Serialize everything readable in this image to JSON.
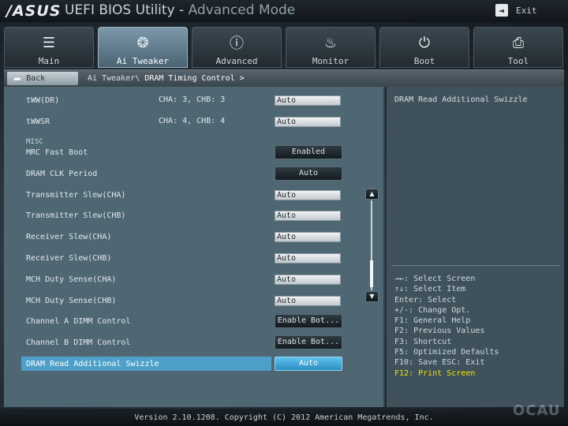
{
  "header": {
    "brand": "/ASUS",
    "title": "UEFI BIOS Utility - ",
    "mode": "Advanced Mode",
    "exit_label": "Exit"
  },
  "tabs": [
    {
      "label": "Main",
      "icon": "list-icon",
      "glyph": "☰"
    },
    {
      "label": "Ai Tweaker",
      "icon": "tweaker-icon",
      "glyph": "❂"
    },
    {
      "label": "Advanced",
      "icon": "advanced-info-icon",
      "glyph": "ⓘ"
    },
    {
      "label": "Monitor",
      "icon": "thermometer-icon",
      "glyph": "♨"
    },
    {
      "label": "Boot",
      "icon": "power-icon",
      "glyph": "⏻"
    },
    {
      "label": "Tool",
      "icon": "printer-icon",
      "glyph": "⎙"
    }
  ],
  "active_tab": "Ai Tweaker",
  "breadcrumb": {
    "back_label": "Back",
    "path": "Ai Tweaker\\ ",
    "current": "DRAM Timing Control >"
  },
  "settings": {
    "twr": {
      "label": "tWW(DR)",
      "channels": "CHA:    3, CHB:    3",
      "value": "Auto"
    },
    "twwsr": {
      "label": "tWWSR",
      "channels": "CHA:    4, CHB:    4",
      "value": "Auto"
    },
    "section_misc": "MISC",
    "mrc_fast_boot": {
      "label": "MRC Fast Boot",
      "value": "Enabled"
    },
    "dram_clk_period": {
      "label": "DRAM CLK Period",
      "value": "Auto"
    },
    "tx_slew_cha": {
      "label": "Transmitter Slew(CHA)",
      "value": "Auto"
    },
    "tx_slew_chb": {
      "label": "Transmitter Slew(CHB)",
      "value": "Auto"
    },
    "rx_slew_cha": {
      "label": "Receiver Slew(CHA)",
      "value": "Auto"
    },
    "rx_slew_chb": {
      "label": "Receiver Slew(CHB)",
      "value": "Auto"
    },
    "mch_duty_cha": {
      "label": "MCH Duty Sense(CHA)",
      "value": "Auto"
    },
    "mch_duty_chb": {
      "label": "MCH Duty Sense(CHB)",
      "value": "Auto"
    },
    "ch_a_dimm": {
      "label": "Channel A DIMM Control",
      "value": "Enable Bot..."
    },
    "ch_b_dimm": {
      "label": "Channel B DIMM Control",
      "value": "Enable Bot..."
    },
    "dram_read_swizzle": {
      "label": "DRAM Read Additional Swizzle",
      "value": "Auto"
    }
  },
  "help": {
    "description": "DRAM Read Additional Swizzle",
    "keys": [
      "→←: Select Screen",
      "↑↓: Select Item",
      "Enter: Select",
      "+/-: Change Opt.",
      "F1: General Help",
      "F2: Previous Values",
      "F3: Shortcut",
      "F5: Optimized Defaults",
      "F10: Save  ESC: Exit"
    ],
    "highlight_key": "F12: Print Screen"
  },
  "footer": "Version 2.10.1208. Copyright (C) 2012 American Megatrends, Inc.",
  "watermark": "OCAU",
  "colors": {
    "accent": "#4ea0c8",
    "highlight_text": "#f4e400",
    "panel": "#4f6773"
  }
}
